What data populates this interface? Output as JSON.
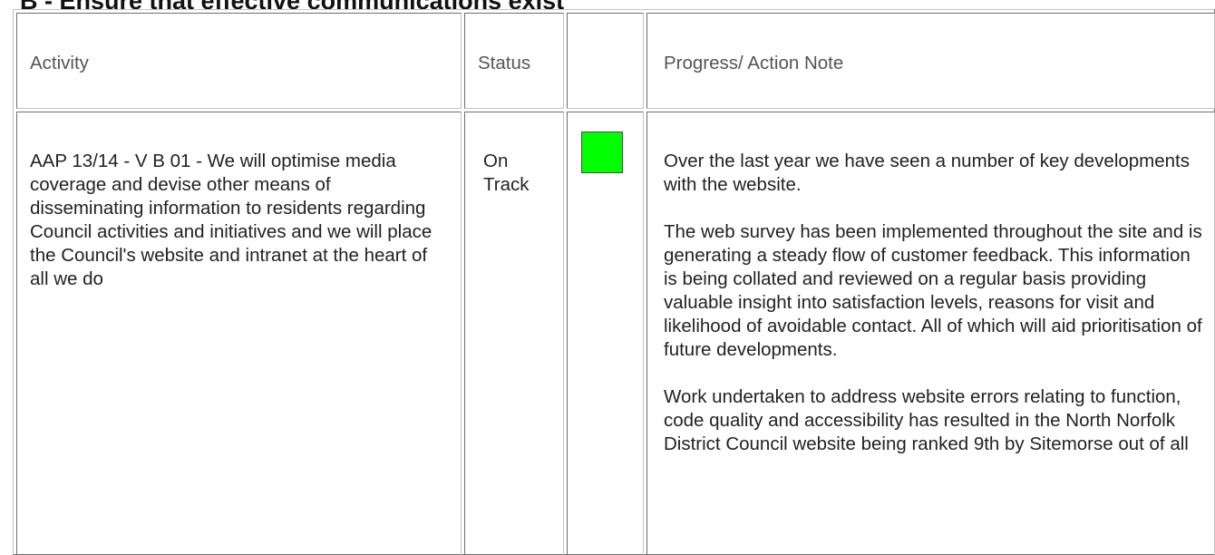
{
  "heading": "B - Ensure that effective communications exist",
  "columns": {
    "activity": "Activity",
    "status": "Status",
    "indicator": "",
    "progress": "Progress/ Action Note"
  },
  "row": {
    "activity": "AAP 13/14 - V B 01 - We will optimise media coverage and devise other means of disseminating information to residents regarding Council activities and initiatives and we will place the Council's website and intranet at the heart of all we do",
    "status_line1": "On",
    "status_line2": "Track",
    "status_color": "#00ff00",
    "progress_paragraphs": [
      "Over the last year we have seen a number of key developments with the website.",
      "The web survey has been implemented throughout the site and is generating a steady flow of customer feedback. This information is being collated and reviewed on a regular basis providing valuable insight into satisfaction levels, reasons for visit and likelihood of avoidable contact. All of which will aid prioritisation of future developments.",
      "Work undertaken to address website errors relating to function, code quality and accessibility has resulted in the North Norfolk District Council website being ranked 9th by Sitemorse out of all"
    ]
  }
}
